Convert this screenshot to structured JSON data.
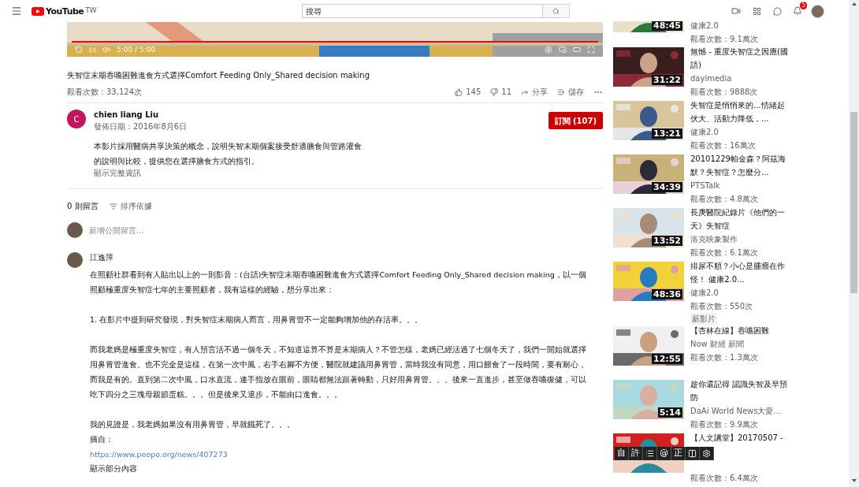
{
  "header": {
    "logo": "YouTube",
    "region": "TW",
    "search": {
      "placeholder": "搜尋"
    },
    "notifications": "5"
  },
  "player": {
    "time": "5:00 / 5:00",
    "level": 1
  },
  "video": {
    "title": "失智症末期吞嚥困難進食方式選擇Comfort Feeding Only_Shared decision making",
    "views": "觀看次數：33,124次",
    "likes": "145",
    "dislikes": "11",
    "share": "分享",
    "save": "儲存"
  },
  "channel": {
    "initial": "C",
    "name": "chien liang Liu",
    "date": "發佈日期：2016年8月6日",
    "subscribe": "訂閱 (107)",
    "description": [
      "本影片採用醫病共享決策的概念，說明失智末期個案接受舒適膳食與管路灌食",
      "的說明與比較，提供您在選擇膳食方式的指引。"
    ],
    "show_more": "顯示完整資訊"
  },
  "comments": {
    "count": "0 則留言",
    "sort": "排序依據",
    "add_placeholder": "新增公開留言...",
    "items": [
      {
        "author": "江逸萍",
        "paragraphs": [
          "在照顧社群看到有人貼出以上的一則影音：(台語)失智症末期吞嚥困難進食方式選擇Comfort Feeding Only_Shared decision making，以一個照顧極重度失智症七年的主要照顧者，我有這樣的經驗，想分享出來：",
          "1. 在影片中提到研究發現，對失智症末期病人而言，用鼻胃管不一定能夠增加他的存活率。。。",
          "而我老媽是極重度失智症，有人預言活不過一個冬天，不知道這算不算是末期病人？不管怎樣，老媽已經活過了七個冬天了，我們一開始就選擇用鼻胃管進食。也不完全是這樣，在第一次中風，右手右腳不方便，醫院就建議用鼻胃管，當時我沒有同意，用口餵食了一段時間，要有耐心，而我是有的。直到第二次中風，口水直流，連手指放在眼前，眼睛都無法跟著轉動，只好用鼻胃管。。。後來一直進步，甚至做吞嚥復健，可以吃下四分之三塊母親節蛋糕。。。但是後來又退步，不能由口進食。。。",
          "我的見證是，我老媽如果沒有用鼻胃管，早就餓死了。。。"
        ],
        "source_label": "摘自：",
        "link": "https://www.peopo.org/news/407273",
        "show_less": "顯示部分內容"
      }
    ]
  },
  "related": [
    {
      "duration": "48:45",
      "channel": "健康2.0",
      "views": "觀看次數：9.1萬次"
    },
    {
      "title": "無憾 - 重度失智症之因應(國語)",
      "duration": "31:22",
      "channel": "dayimedia",
      "views": "觀看次數：9888次"
    },
    {
      "title": "失智症是悄悄來的...情緒起伏大、活動力降低，...",
      "duration": "13:21",
      "channel": "健康2.0",
      "views": "觀看次數：16萬次"
    },
    {
      "title": "20101229帕金森？阿茲海默？失智症？怎麼分...",
      "duration": "34:39",
      "channel": "PTSTalk",
      "views": "觀看次數：4.8萬次"
    },
    {
      "title": "長庚醫院紀錄片《他們的一天》失智症",
      "duration": "13:52",
      "channel": "洛克映象製作",
      "views": "觀看次數：6.1萬次"
    },
    {
      "title": "排尿不順？小心是腫瘤在作怪！ 健康2.0...",
      "duration": "48:36",
      "channel": "健康2.0",
      "views": "觀看次數：550次",
      "badge": "新影片"
    },
    {
      "title": "【杏林在線】吞嚥困難",
      "duration": "12:55",
      "channel": "Now 財經 新聞",
      "views": "觀看次數：1.3萬次"
    },
    {
      "title": "趁你還記得 認識失智及早預防",
      "duration": "5:14",
      "channel": "DaAi World News大愛...",
      "views": "觀看次數：9.9萬次"
    },
    {
      "title": "【人文講堂】20170507 -",
      "views": "觀看次數：6.4萬次"
    }
  ],
  "ime_toolbar": [
    {
      "kind": "char",
      "text": "自"
    },
    {
      "kind": "char",
      "text": "許"
    },
    {
      "kind": "list"
    },
    {
      "kind": "char",
      "text": "@"
    },
    {
      "kind": "char",
      "text": "正"
    },
    {
      "kind": "half"
    },
    {
      "kind": "gear"
    }
  ]
}
